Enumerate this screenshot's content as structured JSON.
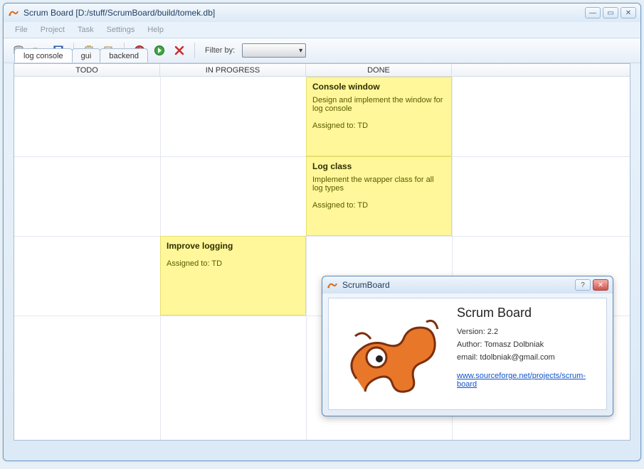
{
  "window": {
    "title": "Scrum Board [D:/stuff/ScrumBoard/build/tomek.db]"
  },
  "menu": {
    "file": "File",
    "project": "Project",
    "task": "Task",
    "settings": "Settings",
    "help": "Help"
  },
  "toolbar": {
    "filter_label": "Filter by:"
  },
  "tabs": {
    "t0": "log console",
    "t1": "gui",
    "t2": "backend"
  },
  "columns": {
    "c0": "TODO",
    "c1": "IN PROGRESS",
    "c2": "DONE"
  },
  "cards": {
    "card0": {
      "title": "Console window",
      "desc": "Design and implement the window for log console",
      "assigned": "Assigned to: TD"
    },
    "card1": {
      "title": "Log class",
      "desc": "Implement the wrapper class for all log types",
      "assigned": "Assigned to: TD"
    },
    "card2": {
      "title": "Improve logging",
      "desc": "",
      "assigned": "Assigned to: TD"
    }
  },
  "about": {
    "title": "ScrumBoard",
    "heading": "Scrum Board",
    "version": "Version: 2.2",
    "author": "Author: Tomasz Dolbniak",
    "email": "email: tdolbniak@gmail.com",
    "link": "www.sourceforge.net/projects/scrum-board"
  }
}
